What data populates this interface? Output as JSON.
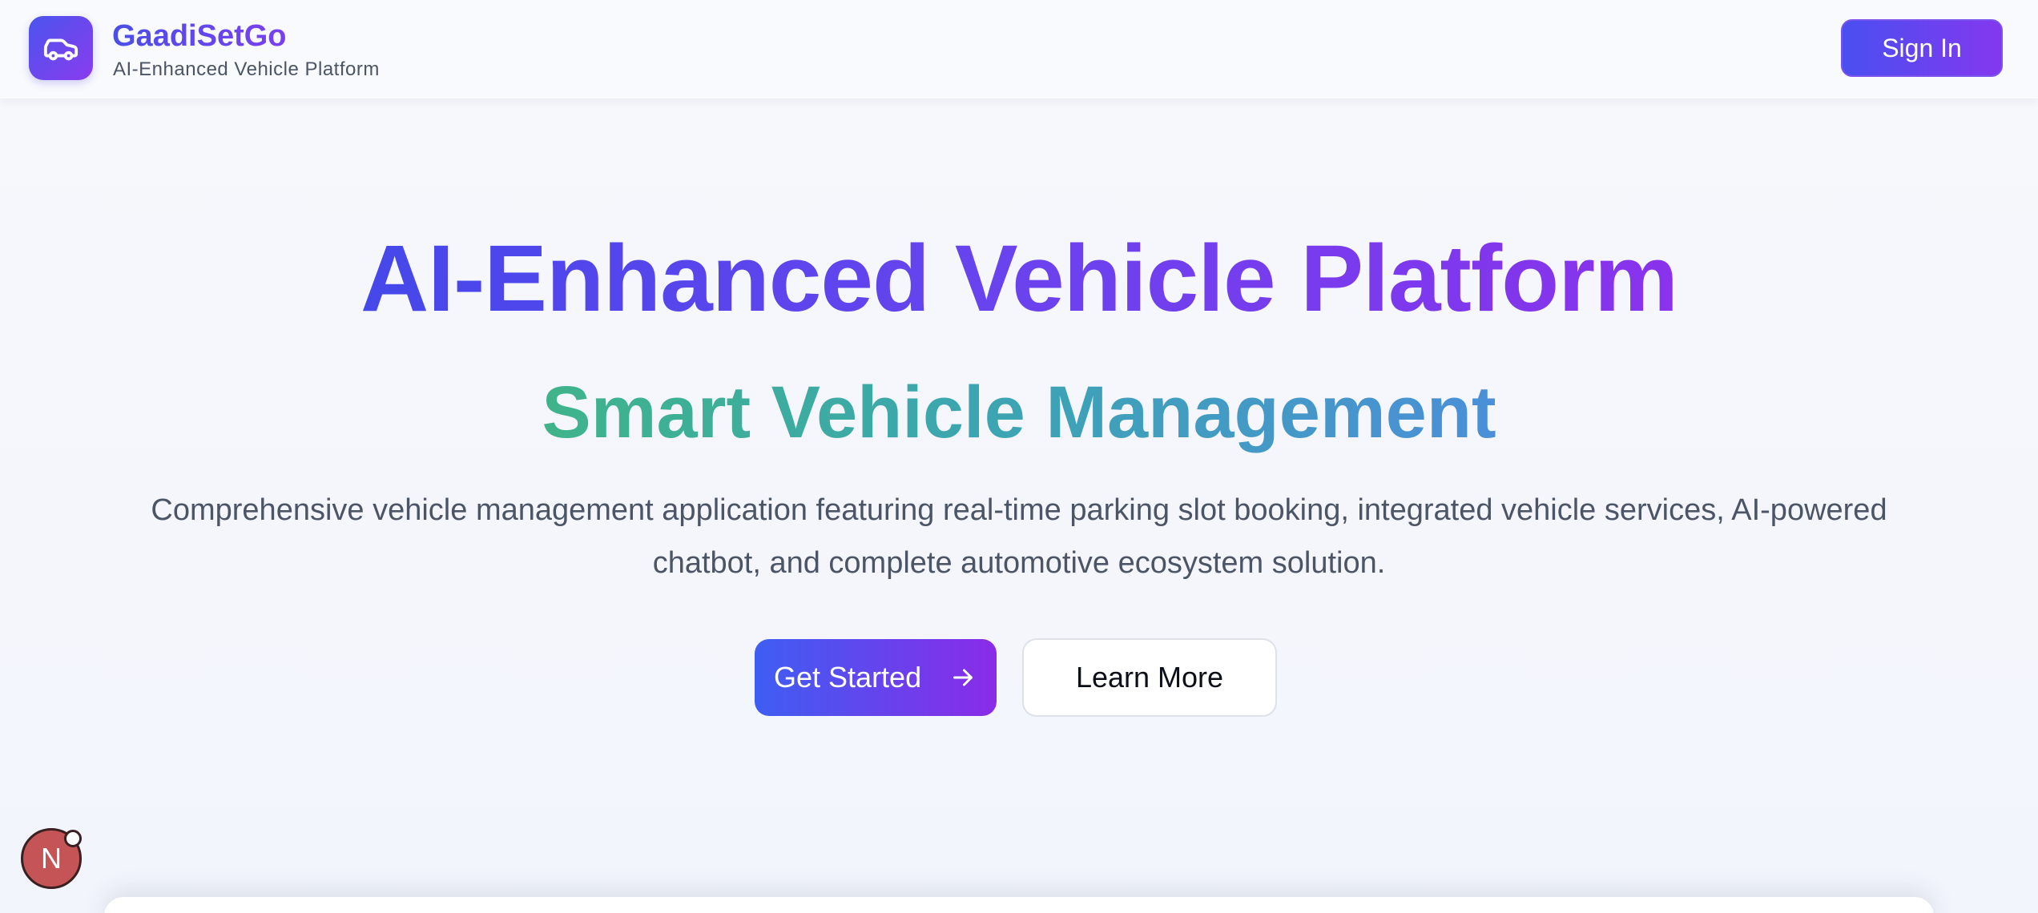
{
  "header": {
    "logo_icon": "car-icon",
    "brand_name": "GaadiSetGo",
    "brand_tagline": "AI-Enhanced Vehicle Platform",
    "signin_label": "Sign In"
  },
  "hero": {
    "title": "AI-Enhanced Vehicle Platform",
    "subtitle": "Smart Vehicle Management",
    "description": "Comprehensive vehicle management application featuring real-time parking slot booking, integrated vehicle services, AI-powered chatbot, and complete automotive ecosystem solution.",
    "primary_cta": "Get Started",
    "primary_cta_icon": "arrow-right-icon",
    "secondary_cta": "Learn More"
  },
  "dev_indicator": {
    "label": "N"
  },
  "colors": {
    "brand_gradient_start": "#4a4ff0",
    "brand_gradient_end": "#8338ee",
    "subtitle_gradient_start": "#3fb48a",
    "subtitle_gradient_end": "#4a8fd8",
    "text_muted": "#4b5566",
    "dev_badge": "#c45455"
  }
}
